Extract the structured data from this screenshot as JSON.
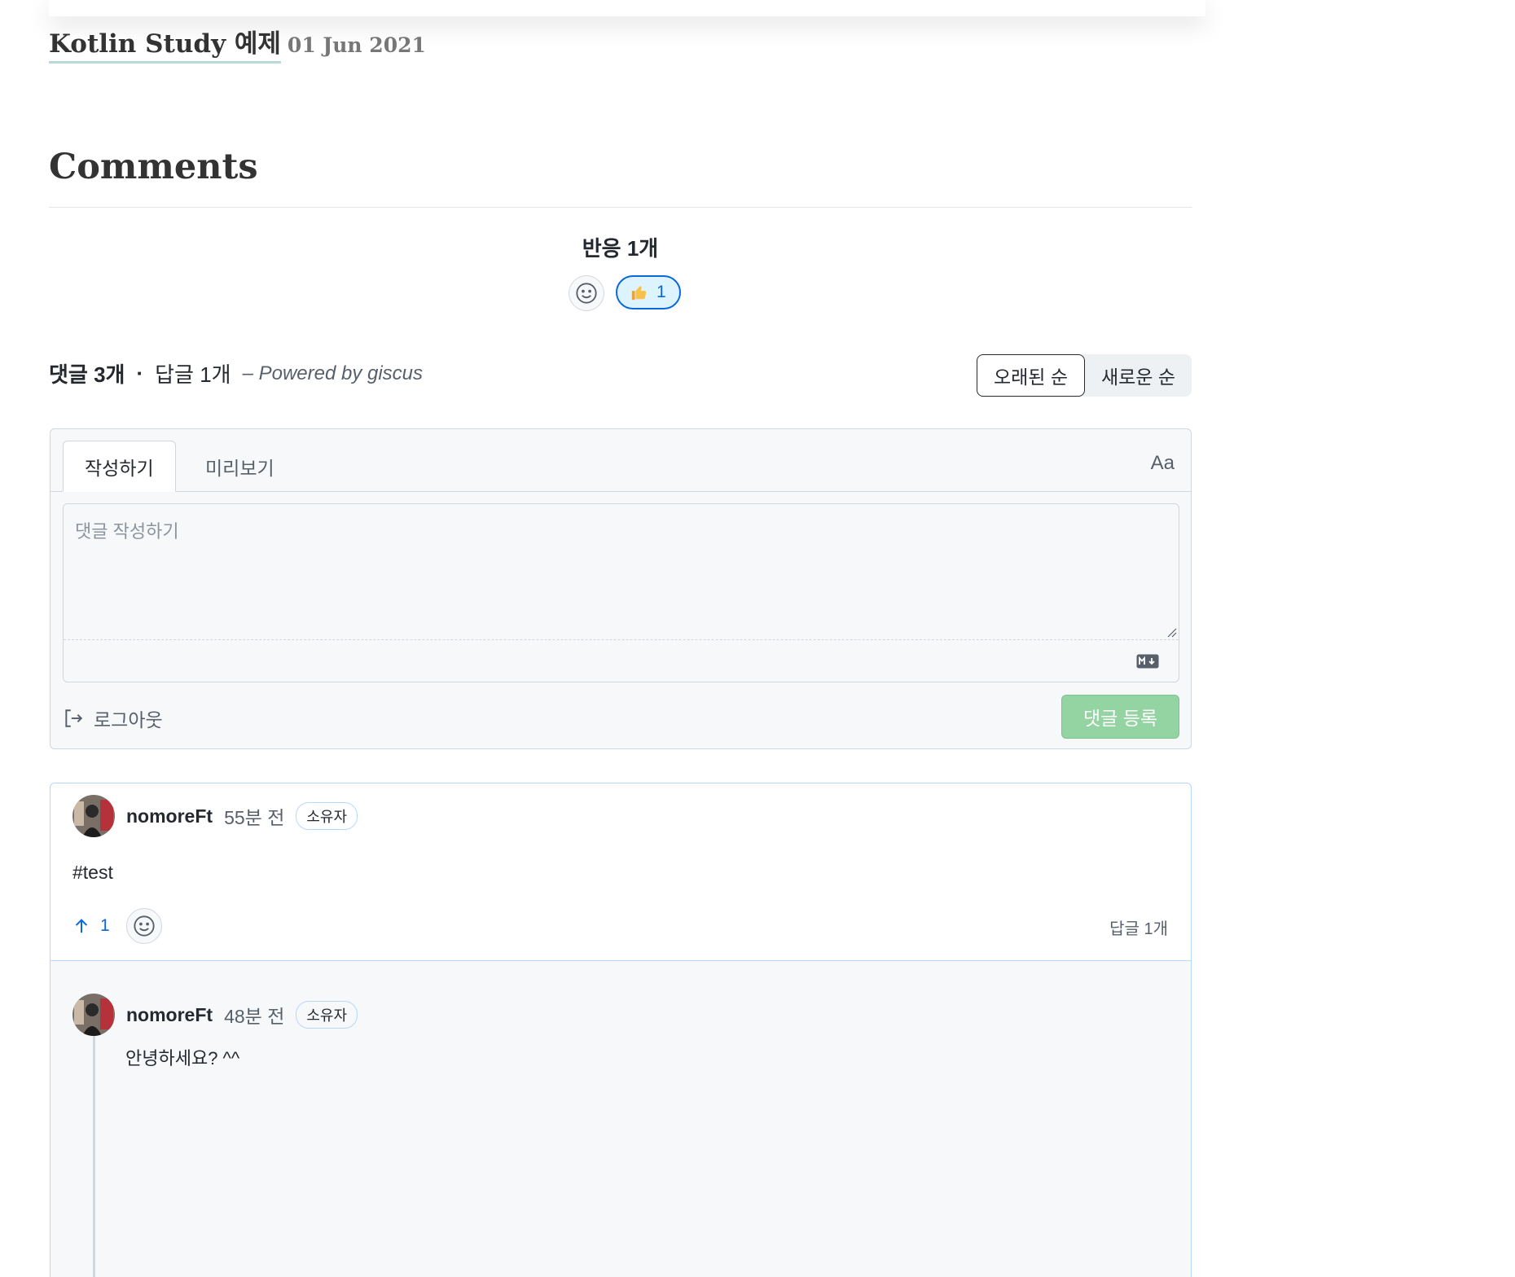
{
  "post": {
    "title": "Kotlin Study 예제",
    "date": "01 Jun 2021"
  },
  "comments_title": "Comments",
  "reactions": {
    "title": "반응 1개",
    "thumbs_count": "1"
  },
  "meta": {
    "comments": "댓글 3개",
    "dot": "·",
    "replies": "답글 1개",
    "powered": "– Powered by giscus"
  },
  "sort": {
    "oldest": "오래된 순",
    "newest": "새로운 순"
  },
  "editor": {
    "tab_write": "작성하기",
    "tab_preview": "미리보기",
    "font_toggle": "Aa",
    "placeholder": "댓글 작성하기",
    "logout": "로그아웃",
    "submit": "댓글 등록"
  },
  "comment": {
    "author": "nomoreFt",
    "time": "55분 전",
    "badge": "소유자",
    "body": "#test",
    "upvotes": "1",
    "reply_count": "답글 1개"
  },
  "reply": {
    "author": "nomoreFt",
    "time": "48분 전",
    "badge": "소유자",
    "body": "안녕하세요? ^^"
  },
  "colors": {
    "accent": "#0969da",
    "submit": "#94d3a2",
    "border": "#d0d7de"
  }
}
